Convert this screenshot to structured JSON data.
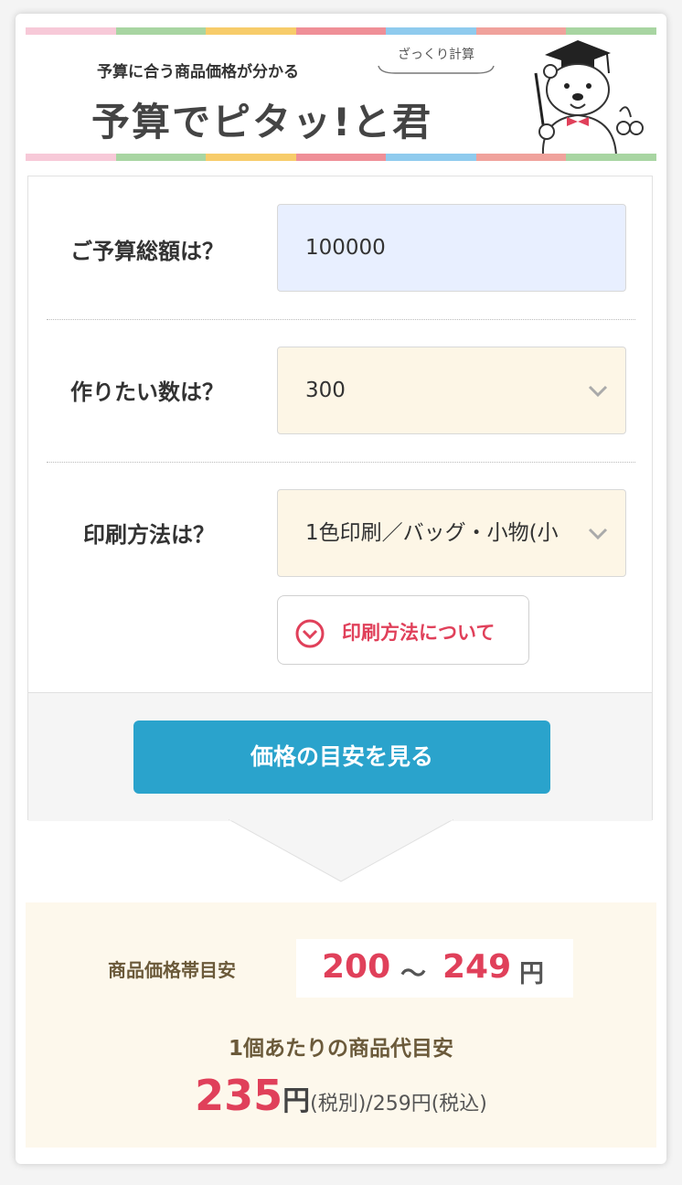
{
  "colors": {
    "stripe": [
      "#f7c9d8",
      "#a8d5a2",
      "#f7cc6a",
      "#ef8f97",
      "#8fcbee",
      "#f0a29c",
      "#a8d5a2"
    ],
    "accent_red": "#e0405a",
    "cta_blue": "#2aa3cc",
    "budget_input_bg": "#e8efff",
    "select_bg": "#fdf6e6",
    "result_bg": "#fdf8ec"
  },
  "header": {
    "subtitle": "予算に合う商品価格が分かる",
    "badge": "ざっくり計算",
    "title": "予算でピタッ!と君",
    "mascot_icon": "mascot-bear-professor-icon"
  },
  "form": {
    "budget": {
      "label": "ご予算総額は？",
      "value": "100000"
    },
    "quantity": {
      "label": "作りたい数は？",
      "value": "300",
      "icon": "chevron-down-icon"
    },
    "print_method": {
      "label": "印刷方法は？",
      "value": "1色印刷／バッグ・小物(小",
      "icon": "chevron-down-icon"
    },
    "about_button": {
      "label": "印刷方法について",
      "icon": "circle-chevron-down-icon"
    },
    "submit_button": "価格の目安を見る"
  },
  "result": {
    "range_label": "商品価格帯目安",
    "range_min": "200",
    "range_sep": "～",
    "range_max": "249",
    "range_unit": "円",
    "per_item_label": "1個あたりの商品代目安",
    "unit_price": "235",
    "unit_yen": "円",
    "unit_rest": "(税別)/259円(税込)"
  }
}
